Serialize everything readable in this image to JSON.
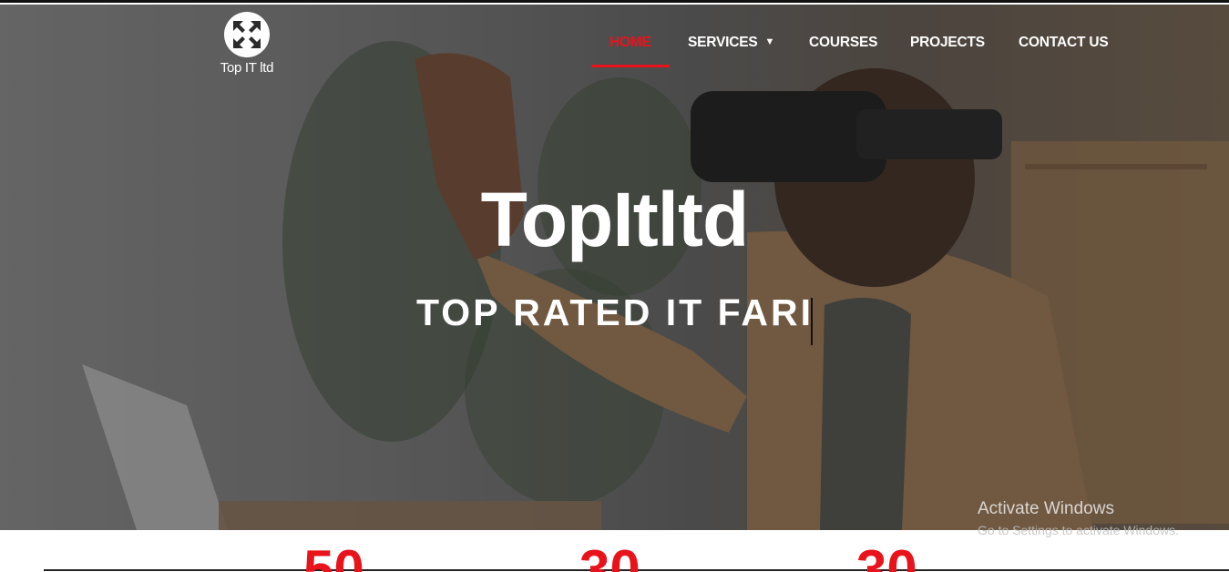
{
  "brand": {
    "logo_text": "Top IT ltd",
    "logo_icon": "arrows-expand-icon"
  },
  "nav": {
    "items": [
      {
        "label": "HOME",
        "active": true
      },
      {
        "label": "SERVICES",
        "has_dropdown": true
      },
      {
        "label": "COURSES"
      },
      {
        "label": "PROJECTS"
      },
      {
        "label": "CONTACT US"
      }
    ],
    "dropdown_icon": "caret-down-icon"
  },
  "hero": {
    "title": "TopItltd",
    "subtitle": "TOP RATED IT FARI"
  },
  "watermark": {
    "title": "Activate Windows",
    "subtitle": "Go to Settings to activate Windows."
  },
  "stats": [
    "50",
    "30",
    "30"
  ],
  "colors": {
    "accent": "#e8131b",
    "nav_text": "#ffffff"
  }
}
